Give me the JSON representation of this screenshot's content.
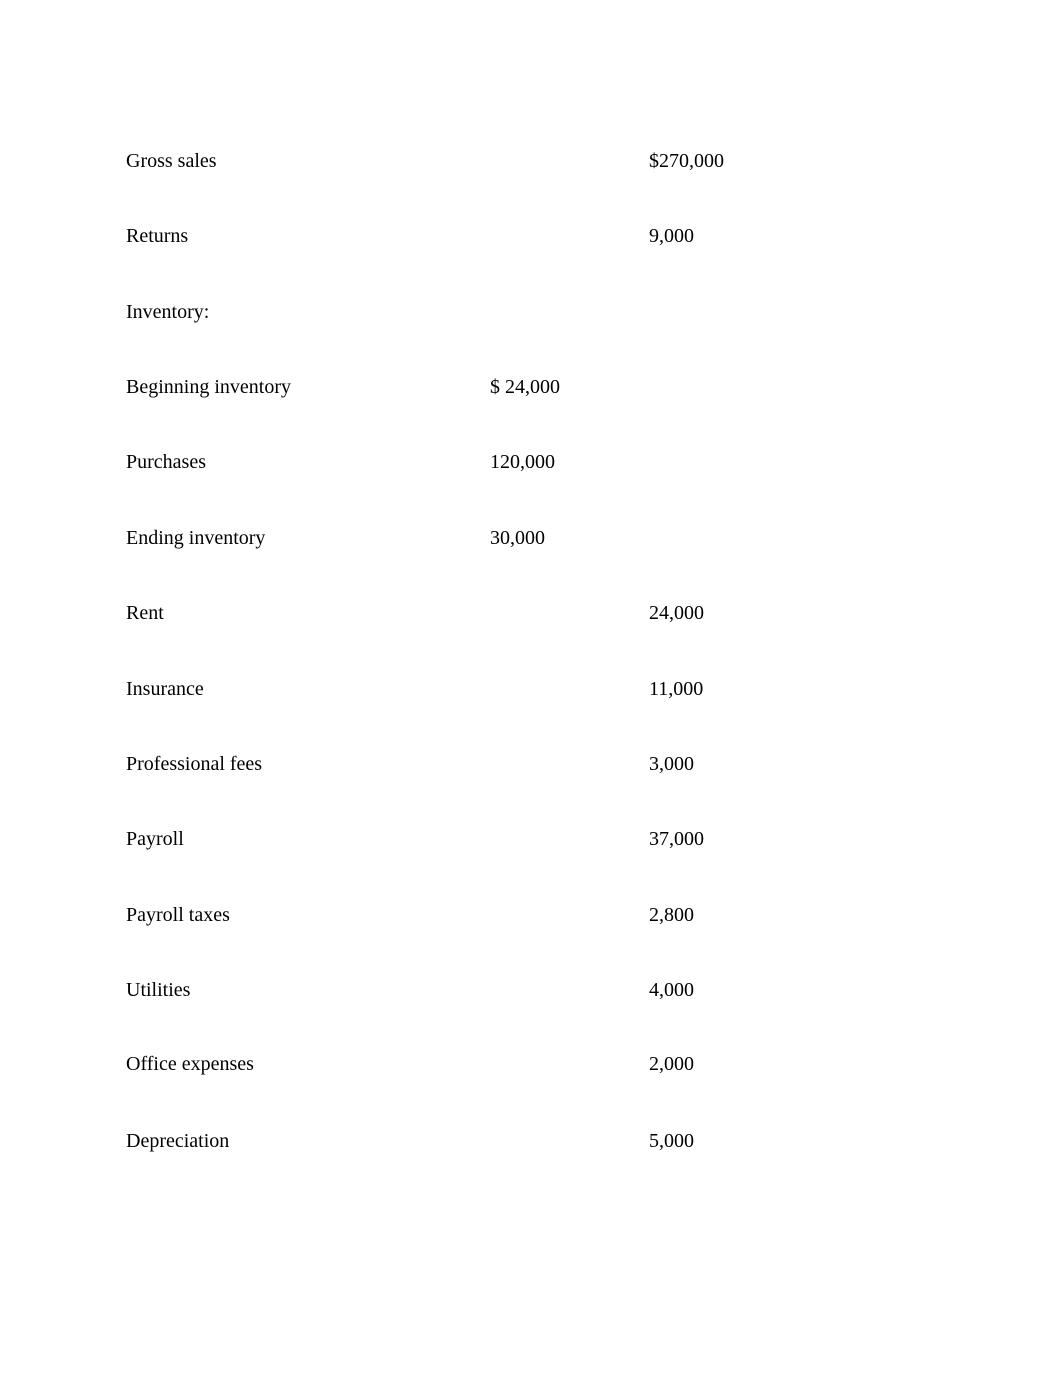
{
  "document": {
    "rows": [
      {
        "label": "Gross sales",
        "subtotal": "",
        "amount": "$270,000"
      },
      {
        "label": "Returns",
        "subtotal": "",
        "amount": "9,000"
      },
      {
        "label": "Inventory:",
        "subtotal": "",
        "amount": ""
      },
      {
        "label": "Beginning inventory",
        "subtotal": "$ 24,000",
        "amount": ""
      },
      {
        "label": "Purchases",
        "subtotal": "120,000",
        "amount": ""
      },
      {
        "label": "Ending inventory",
        "subtotal": "30,000",
        "amount": ""
      },
      {
        "label": "Rent",
        "subtotal": "",
        "amount": "24,000"
      },
      {
        "label": "Insurance",
        "subtotal": "",
        "amount": "11,000"
      },
      {
        "label": "Professional fees",
        "subtotal": "",
        "amount": "3,000"
      },
      {
        "label": "Payroll",
        "subtotal": "",
        "amount": "37,000"
      },
      {
        "label": "Payroll taxes",
        "subtotal": "",
        "amount": "2,800"
      },
      {
        "label": "Utilities",
        "subtotal": "",
        "amount": "4,000"
      },
      {
        "label": "Office expenses",
        "subtotal": "",
        "amount": "2,000"
      },
      {
        "label": "Depreciation",
        "subtotal": "",
        "amount": "5,000"
      }
    ]
  }
}
